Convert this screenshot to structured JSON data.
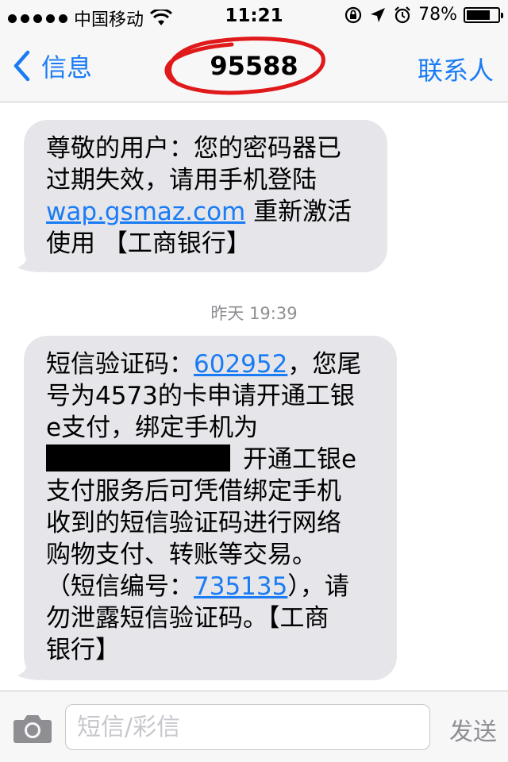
{
  "status_bar": {
    "carrier": "中国移动",
    "time": "11:21",
    "battery_percent": "78%",
    "battery_level": 0.78,
    "icons": [
      "signal-dots-icon",
      "wifi-icon",
      "rotation-lock-icon",
      "location-arrow-icon",
      "alarm-icon",
      "battery-icon"
    ]
  },
  "nav": {
    "back_label": "信息",
    "title": "95588",
    "contact_label": "联系人"
  },
  "messages": [
    {
      "line1": "尊敬的用户：您的密码器已",
      "line2": "过期失效，请用手机登陆",
      "link": "wap.gsmaz.com",
      "line3_rest": " 重新激活",
      "line4": "使用 【工商银行】"
    },
    {
      "timestamp": "昨天 19:39",
      "prefix": "短信验证码：",
      "code": "602952",
      "after_code": "，您尾",
      "line2": "号为4573的卡申请开通工银",
      "line3": "e支付，绑定手机为",
      "after_redact": "开通工银e",
      "line5": "支付服务后可凭借绑定手机",
      "line6": "收到的短信验证码进行网络",
      "line7": "购物支付、转账等交易。",
      "serial_prefix": "（短信编号：",
      "serial": "735135",
      "serial_suffix": "），请",
      "line9": "勿泄露短信验证码。【工商",
      "line10": "银行】"
    }
  ],
  "input": {
    "placeholder": "短信/彩信",
    "send_label": "发送"
  },
  "colors": {
    "accent": "#1a7cf4",
    "bubble": "#e5e5ea",
    "annotation_circle": "#e0191b"
  }
}
